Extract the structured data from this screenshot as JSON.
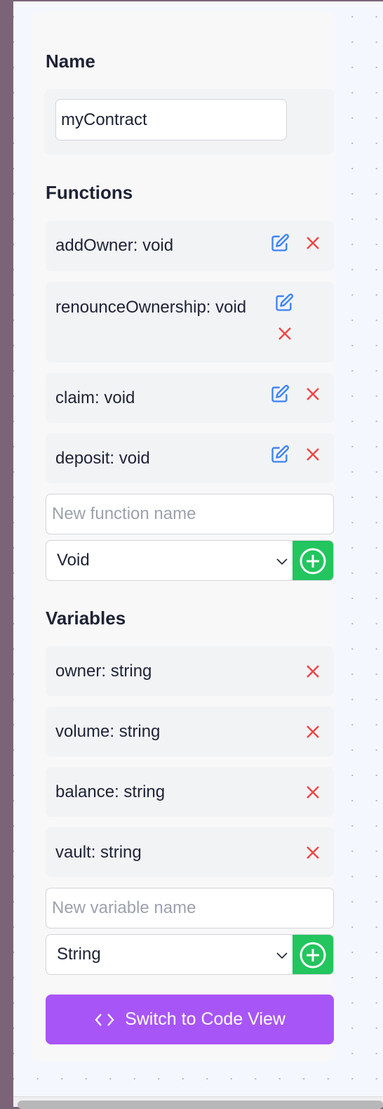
{
  "name_section": {
    "heading": "Name",
    "value": "myContract"
  },
  "functions": {
    "heading": "Functions",
    "items": [
      {
        "label": "addOwner: void"
      },
      {
        "label": "renounceOwnership: void"
      },
      {
        "label": "claim: void"
      },
      {
        "label": "deposit: void"
      }
    ],
    "new_placeholder": "New function name",
    "type_selected": "Void"
  },
  "variables": {
    "heading": "Variables",
    "items": [
      {
        "label": "owner: string"
      },
      {
        "label": "volume: string"
      },
      {
        "label": "balance: string"
      },
      {
        "label": "vault: string"
      }
    ],
    "new_placeholder": "New variable name",
    "type_selected": "String"
  },
  "switch_button": {
    "label": "Switch to Code View",
    "icon": "code-icon"
  },
  "colors": {
    "accent": "#a855f7",
    "add": "#22c55e",
    "edit": "#3b82f6",
    "delete": "#ef4444"
  }
}
